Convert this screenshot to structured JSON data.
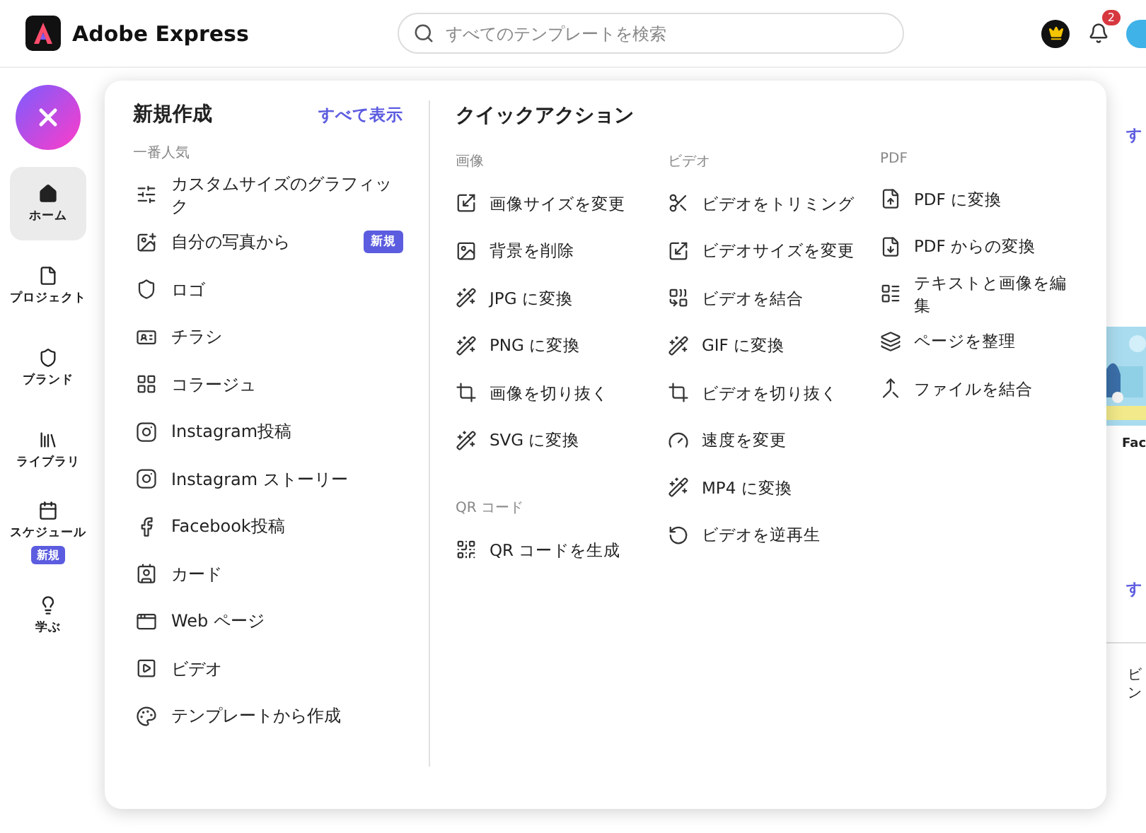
{
  "header": {
    "logo_text": "Adobe Express",
    "search": {
      "placeholder": "すべてのテンプレートを検索"
    },
    "notification_count": "2"
  },
  "rail": {
    "items": [
      {
        "label": "ホーム",
        "selected": true
      },
      {
        "label": "プロジェクト",
        "selected": false
      },
      {
        "label": "ブランド",
        "selected": false
      },
      {
        "label": "ライブラリ",
        "selected": false
      },
      {
        "label": "スケジュール",
        "selected": false,
        "badge": "新規"
      },
      {
        "label": "学ぶ",
        "selected": false
      }
    ]
  },
  "create": {
    "title": "新規作成",
    "view_all": "すべて表示",
    "section": "一番人気",
    "items": [
      {
        "label": "カスタムサイズのグラフィック"
      },
      {
        "label": "自分の写真から",
        "badge": "新規"
      },
      {
        "label": "ロゴ"
      },
      {
        "label": "チラシ"
      },
      {
        "label": "コラージュ"
      },
      {
        "label": "Instagram投稿"
      },
      {
        "label": "Instagram ストーリー"
      },
      {
        "label": "Facebook投稿"
      },
      {
        "label": "カード"
      },
      {
        "label": "Web ページ"
      },
      {
        "label": "ビデオ"
      },
      {
        "label": "テンプレートから作成"
      }
    ]
  },
  "quick_actions": {
    "title": "クイックアクション",
    "columns": [
      {
        "groups": [
          {
            "heading": "画像",
            "items": [
              "画像サイズを変更",
              "背景を削除",
              "JPG に変換",
              "PNG に変換",
              "画像を切り抜く",
              "SVG に変換"
            ]
          },
          {
            "heading": "QR コード",
            "items": [
              "QR コードを生成"
            ]
          }
        ]
      },
      {
        "groups": [
          {
            "heading": "ビデオ",
            "items": [
              "ビデオをトリミング",
              "ビデオサイズを変更",
              "ビデオを結合",
              "GIF に変換",
              "ビデオを切り抜く",
              "速度を変更",
              "MP4 に変換",
              "ビデオを逆再生"
            ]
          }
        ]
      },
      {
        "groups": [
          {
            "heading": "PDF",
            "items": [
              "PDF に変換",
              "PDF からの変換",
              "テキストと画像を編集",
              "ページを整理",
              "ファイルを結合"
            ]
          }
        ]
      }
    ]
  },
  "background": {
    "link_top": "す",
    "thumbnail": {
      "kind": "picture"
    },
    "caption": "Fac",
    "link_bottom": "す",
    "item_lines": [
      "ビ",
      "ン"
    ]
  }
}
